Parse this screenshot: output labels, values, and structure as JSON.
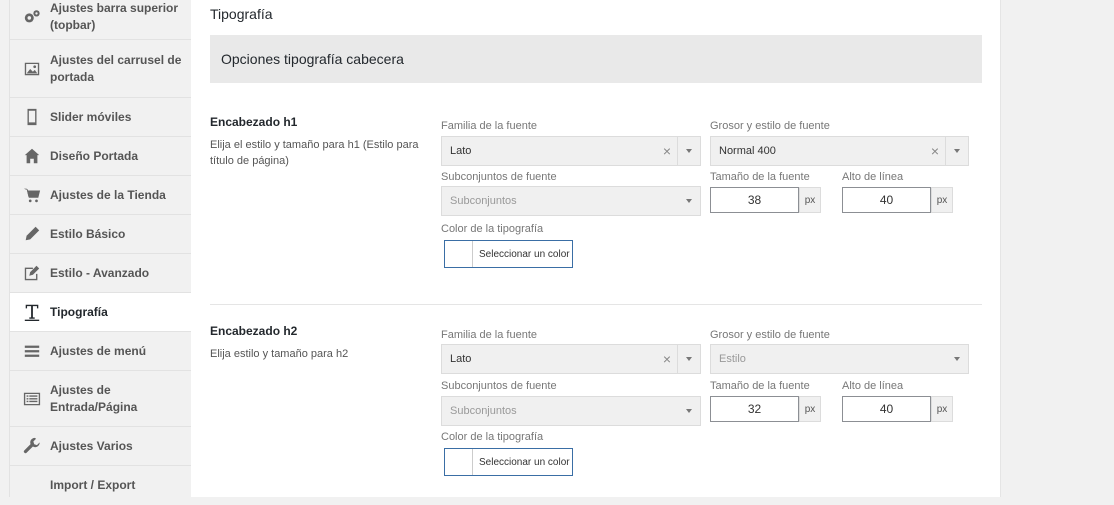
{
  "sidebar": {
    "items": [
      {
        "label": "Ajustes barra superior (topbar)",
        "icon": "gears-icon"
      },
      {
        "label": "Ajustes del carrusel de portada",
        "icon": "image-icon"
      },
      {
        "label": "Slider móviles",
        "icon": "mobile-icon"
      },
      {
        "label": "Diseño Portada",
        "icon": "home-icon"
      },
      {
        "label": "Ajustes de la Tienda",
        "icon": "cart-icon"
      },
      {
        "label": "Estilo Básico",
        "icon": "pencil-icon"
      },
      {
        "label": "Estilo - Avanzado",
        "icon": "edit-icon"
      },
      {
        "label": "Tipografía",
        "icon": "typography-icon"
      },
      {
        "label": "Ajustes de menú",
        "icon": "menu-icon"
      },
      {
        "label": "Ajustes de Entrada/Página",
        "icon": "list-icon"
      },
      {
        "label": "Ajustes Varios",
        "icon": "wrench-icon"
      },
      {
        "label": "Import / Export",
        "icon": ""
      }
    ]
  },
  "page": {
    "title": "Tipografía",
    "section_header": "Opciones tipografía cabecera"
  },
  "h1": {
    "title": "Encabezado h1",
    "desc": "Elija el estilo y tamaño para h1 (Estilo para título de página)",
    "family_label": "Familia de la fuente",
    "family_value": "Lato",
    "weight_label": "Grosor y estilo de fuente",
    "weight_value": "Normal 400",
    "subsets_label": "Subconjuntos de fuente",
    "subsets_value": "Subconjuntos",
    "size_label": "Tamaño de la fuente",
    "size_value": "38",
    "size_unit": "px",
    "lh_label": "Alto de línea",
    "lh_value": "40",
    "lh_unit": "px",
    "color_label": "Color de la tipografía",
    "color_button": "Seleccionar un color"
  },
  "h2": {
    "title": "Encabezado h2",
    "desc": "Elija estilo y tamaño para h2",
    "family_label": "Familia de la fuente",
    "family_value": "Lato",
    "weight_label": "Grosor y estilo de fuente",
    "weight_value": "Estilo",
    "subsets_label": "Subconjuntos de fuente",
    "subsets_value": "Subconjuntos",
    "size_label": "Tamaño de la fuente",
    "size_value": "32",
    "size_unit": "px",
    "lh_label": "Alto de línea",
    "lh_value": "40",
    "lh_unit": "px",
    "color_label": "Color de la tipografía",
    "color_button": "Seleccionar un color"
  }
}
